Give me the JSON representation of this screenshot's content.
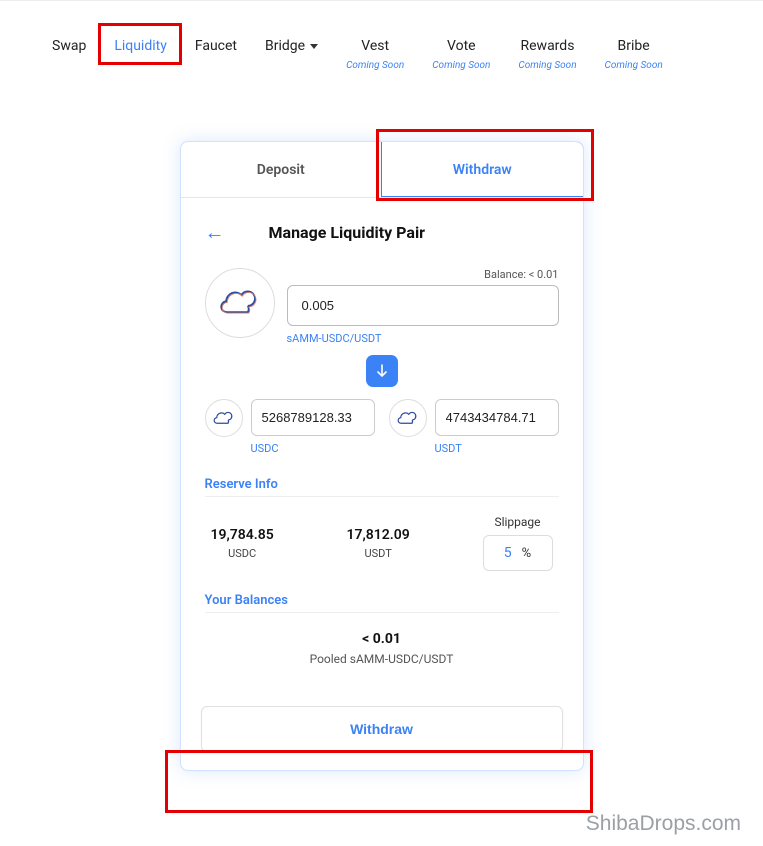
{
  "nav": {
    "swap": "Swap",
    "liquidity": "Liquidity",
    "faucet": "Faucet",
    "bridge": "Bridge",
    "vest": "Vest",
    "vote": "Vote",
    "rewards": "Rewards",
    "bribe": "Bribe",
    "coming_soon": "Coming Soon"
  },
  "tabs": {
    "deposit": "Deposit",
    "withdraw": "Withdraw"
  },
  "page": {
    "title": "Manage Liquidity Pair"
  },
  "lp": {
    "balance_label": "Balance: < 0.01",
    "amount": "0.005",
    "token": "sAMM-USDC/USDT"
  },
  "out": {
    "a_value": "5268789128.33",
    "a_token": "USDC",
    "b_value": "4743434784.71",
    "b_token": "USDT"
  },
  "reserve": {
    "title": "Reserve Info",
    "a_value": "19,784.85",
    "a_token": "USDC",
    "b_value": "17,812.09",
    "b_token": "USDT",
    "slippage_label": "Slippage",
    "slippage_value": "5",
    "percent": "%"
  },
  "balances": {
    "title": "Your Balances",
    "value": "< 0.01",
    "label": "Pooled sAMM-USDC/USDT"
  },
  "action": {
    "withdraw": "Withdraw"
  },
  "watermark": "ShibaDrops.com"
}
